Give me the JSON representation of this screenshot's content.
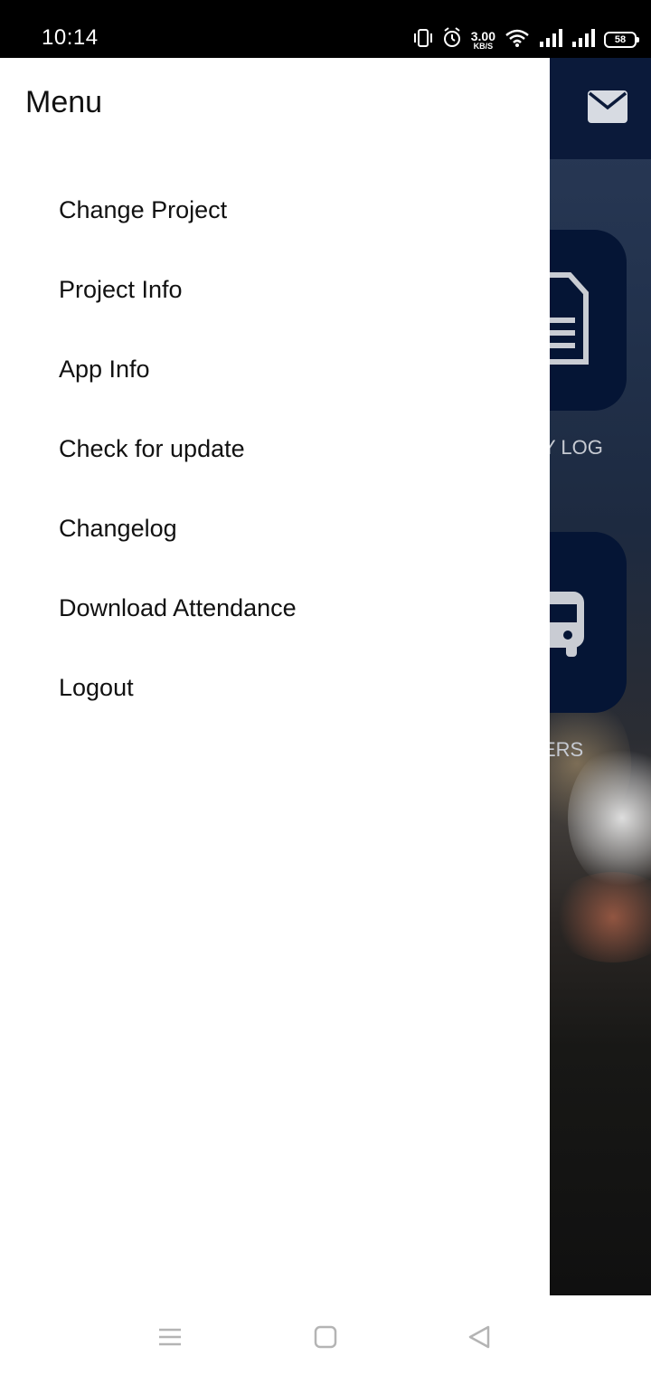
{
  "status_bar": {
    "time": "10:14",
    "net_speed_value": "3.00",
    "net_speed_unit": "KB/S",
    "battery": "58",
    "icons": [
      "vibrate-icon",
      "alarm-icon",
      "wifi-icon",
      "signal-icon",
      "signal-icon",
      "battery-icon"
    ]
  },
  "drawer": {
    "title": "Menu",
    "items": [
      {
        "label": "Change Project"
      },
      {
        "label": "Project Info"
      },
      {
        "label": "App Info"
      },
      {
        "label": "Check for update"
      },
      {
        "label": "Changelog"
      },
      {
        "label": "Download Attendance"
      },
      {
        "label": "Logout"
      }
    ]
  },
  "background_app": {
    "header_icon": "mail-icon",
    "tiles": [
      {
        "icon": "document-icon",
        "label": "Y LOG"
      },
      {
        "icon": "bus-icon",
        "label": "ERS"
      }
    ],
    "colors": {
      "header": "#0b1a3a",
      "tile": "#051535"
    }
  },
  "nav_bar": {
    "icons": [
      "menu-icon",
      "home-square-icon",
      "back-triangle-icon"
    ]
  }
}
